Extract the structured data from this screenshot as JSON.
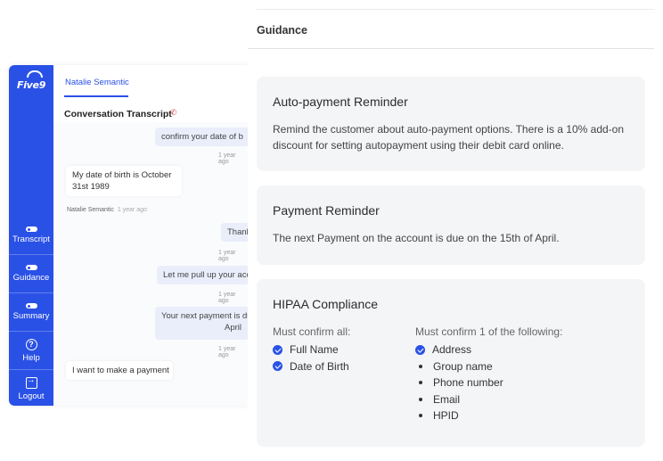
{
  "app": {
    "logo_text": "Five9",
    "nav": [
      {
        "id": "transcript",
        "label": "Transcript",
        "icon": "toggle-icon"
      },
      {
        "id": "guidance",
        "label": "Guidance",
        "icon": "toggle-icon"
      },
      {
        "id": "summary",
        "label": "Summary",
        "icon": "toggle-icon"
      },
      {
        "id": "help",
        "label": "Help",
        "icon": "help-icon",
        "glyph": "?"
      },
      {
        "id": "logout",
        "label": "Logout",
        "icon": "logout-icon"
      }
    ],
    "tab": "Natalie Semantic",
    "conversation_title": "Conversation Transcript",
    "messages": [
      {
        "type": "out",
        "text": "confirm your date of b"
      },
      {
        "type": "ts",
        "text": "1 year ago"
      },
      {
        "type": "in",
        "text": "My date of birth is October 31st 1989"
      },
      {
        "type": "sender",
        "name": "Natalie Semantic",
        "time": "1 year ago"
      },
      {
        "type": "out",
        "text": "Thank"
      },
      {
        "type": "ts",
        "text": "1 year ago"
      },
      {
        "type": "out",
        "text": "Let me pull up your acco"
      },
      {
        "type": "ts",
        "text": "1 year ago"
      },
      {
        "type": "out",
        "text_line1": "Your next payment is du",
        "text_line2": "April"
      },
      {
        "type": "ts",
        "text": "1 year ago"
      },
      {
        "type": "in",
        "text": "I want to make a payment"
      }
    ]
  },
  "guidance": {
    "title": "Guidance",
    "cards": [
      {
        "title": "Auto-payment Reminder",
        "body": "Remind the customer about auto-payment options. There is a 10% add-on discount for setting autopayment using their debit card online."
      },
      {
        "title": "Payment Reminder",
        "body": "The next Payment on the account is due on the 15th of April."
      },
      {
        "title": "HIPAA Compliance",
        "confirm_all_label": "Must confirm all:",
        "confirm_all": [
          "Full Name",
          "Date of Birth"
        ],
        "confirm_one_label": "Must confirm 1 of the following:",
        "confirm_one_checked": [
          "Address"
        ],
        "confirm_one": [
          "Group name",
          "Phone number",
          "Email",
          "HPID"
        ]
      }
    ]
  },
  "colors": {
    "accent": "#2a51e6",
    "card_bg": "#f4f5f7"
  }
}
